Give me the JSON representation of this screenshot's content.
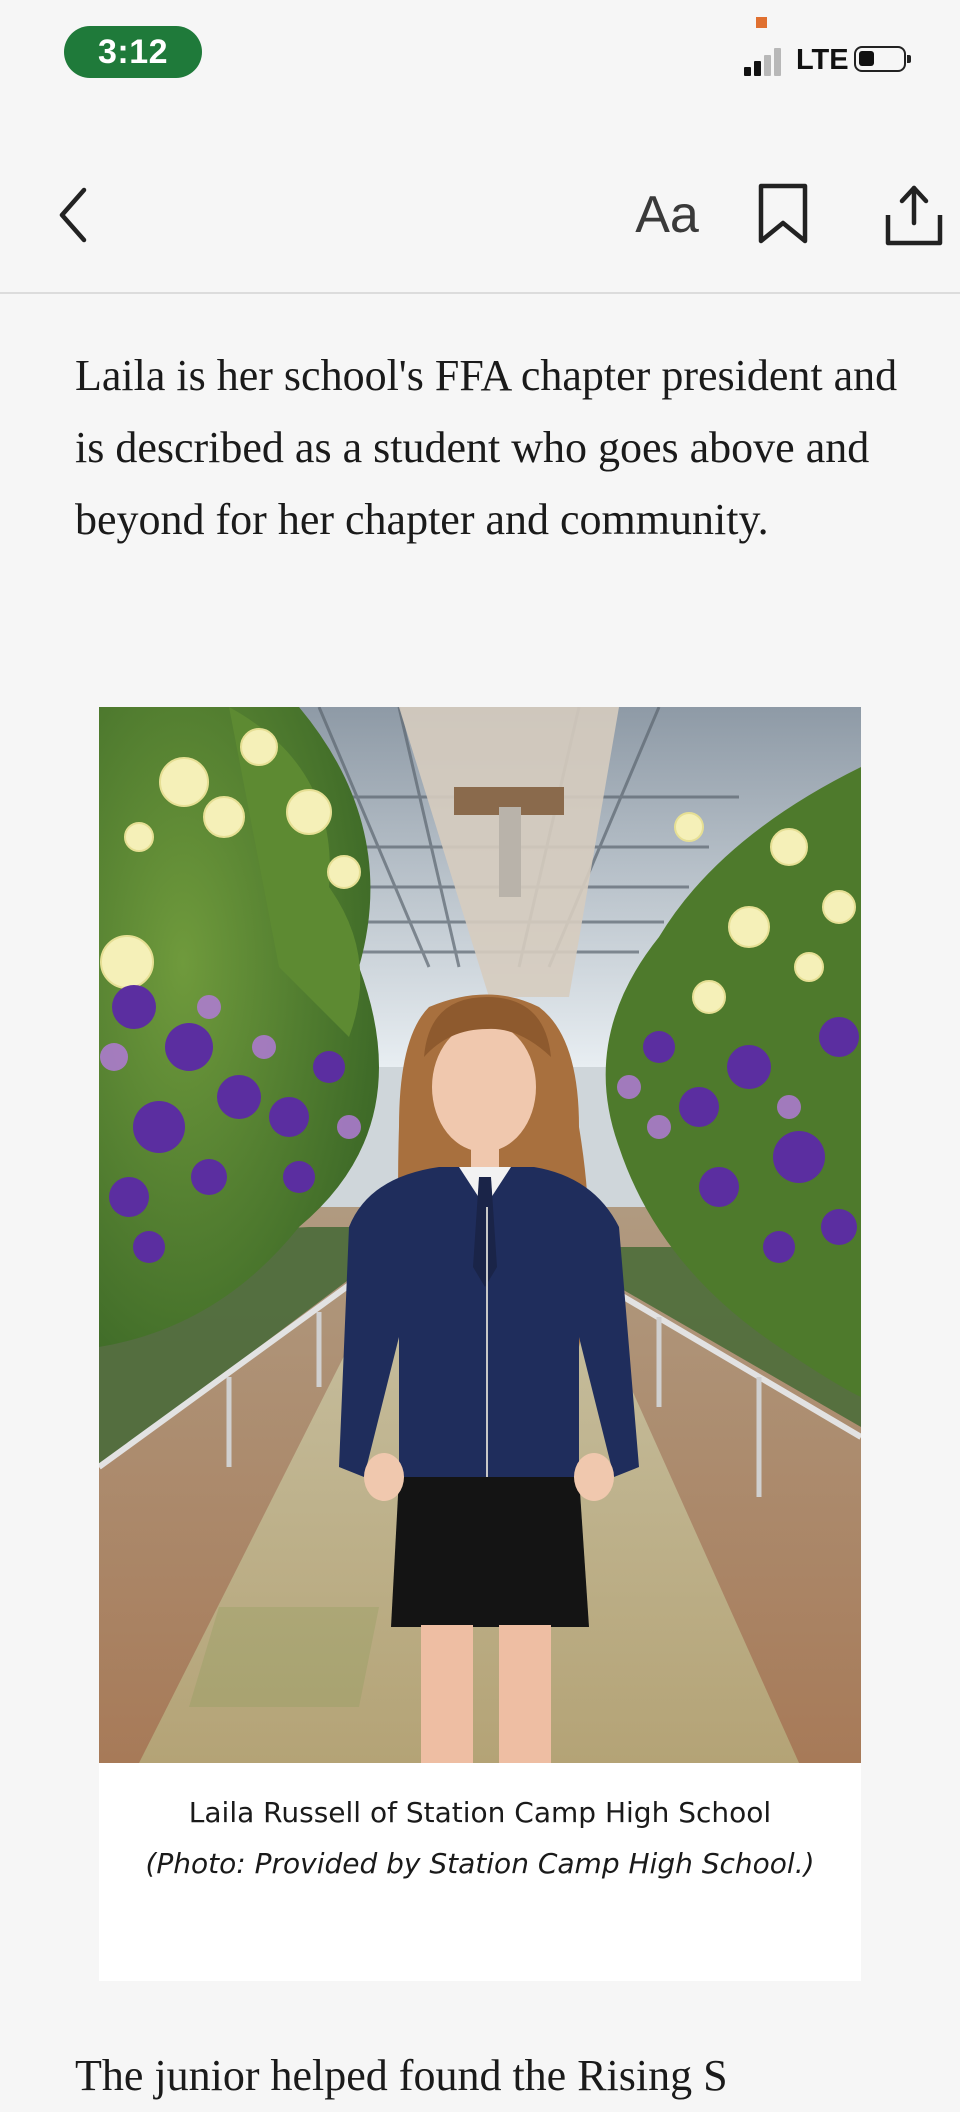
{
  "status_bar": {
    "time": "3:12",
    "network": "LTE",
    "signal_bars_active": 2,
    "signal_bars_total": 4,
    "battery_level": 0.35
  },
  "toolbar": {
    "back_icon": "chevron-left-icon",
    "text_size_label": "Aa",
    "bookmark_icon": "bookmark-icon",
    "share_icon": "share-icon"
  },
  "article": {
    "paragraph": "Laila is her school's FFA chapter president and is described as a student who goes above and beyond for her chapter and community.",
    "figure": {
      "caption": "Laila Russell of Station Camp High School",
      "credit": "(Photo: Provided by Station Camp High School.)"
    },
    "next_paragraph_partial": "The junior helped found the Rising S"
  },
  "colors": {
    "time_pill": "#1f7a3a",
    "background": "#f6f6f6",
    "text": "#1a1a1a",
    "orange_indicator": "#e07030"
  }
}
